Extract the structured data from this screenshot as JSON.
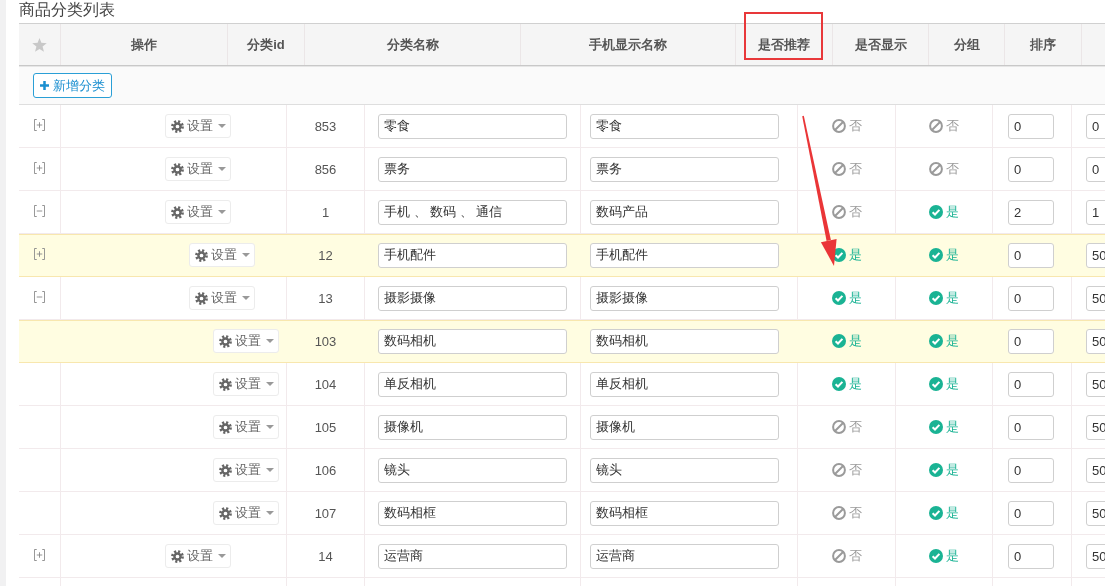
{
  "page": {
    "title": "商品分类列表"
  },
  "table": {
    "columns": [
      {
        "kind": "star",
        "highlighted": false
      },
      {
        "kind": "text",
        "label": "操作",
        "highlighted": false
      },
      {
        "kind": "text",
        "label": "分类id",
        "highlighted": false
      },
      {
        "kind": "text",
        "label": "分类名称",
        "highlighted": false
      },
      {
        "kind": "text",
        "label": "手机显示名称",
        "highlighted": false
      },
      {
        "kind": "text",
        "label": "是否推荐",
        "highlighted": true
      },
      {
        "kind": "text",
        "label": "是否显示",
        "highlighted": false
      },
      {
        "kind": "text",
        "label": "分组",
        "highlighted": false
      },
      {
        "kind": "text",
        "label": "排序",
        "highlighted": false
      }
    ],
    "toolbar": {
      "add_button": "新增分类"
    },
    "rows": [
      {
        "id": "853",
        "action": "设置",
        "name": "零食",
        "mobile_name": "零食",
        "recommended": {
          "on": false,
          "label": "否"
        },
        "visible": {
          "on": false,
          "label": "否"
        },
        "group": "0",
        "sort": "0",
        "expanded": false,
        "selected": false
      },
      {
        "id": "856",
        "action": "设置",
        "name": "票务",
        "mobile_name": "票务",
        "recommended": {
          "on": false,
          "label": "否"
        },
        "visible": {
          "on": false,
          "label": "否"
        },
        "group": "0",
        "sort": "0",
        "expanded": false,
        "selected": false
      },
      {
        "id": "1",
        "action": "设置",
        "name": "手机 、 数码 、 通信",
        "mobile_name": "数码产品",
        "recommended": {
          "on": false,
          "label": "否"
        },
        "visible": {
          "on": true,
          "label": "是"
        },
        "group": "2",
        "sort": "1",
        "expanded": true,
        "selected": false,
        "children": [
          {
            "id": "12",
            "action": "设置",
            "name": "手机配件",
            "mobile_name": "手机配件",
            "recommended": {
              "on": true,
              "label": "是"
            },
            "visible": {
              "on": true,
              "label": "是"
            },
            "group": "0",
            "sort": "50",
            "expanded": false,
            "selected": true
          },
          {
            "id": "13",
            "action": "设置",
            "name": "摄影摄像",
            "mobile_name": "摄影摄像",
            "recommended": {
              "on": true,
              "label": "是"
            },
            "visible": {
              "on": true,
              "label": "是"
            },
            "group": "0",
            "sort": "50",
            "expanded": true,
            "selected": false,
            "children": [
              {
                "id": "103",
                "action": "设置",
                "name": "数码相机",
                "mobile_name": "数码相机",
                "recommended": {
                  "on": true,
                  "label": "是"
                },
                "visible": {
                  "on": true,
                  "label": "是"
                },
                "group": "0",
                "sort": "50",
                "selected": true
              },
              {
                "id": "104",
                "action": "设置",
                "name": "单反相机",
                "mobile_name": "单反相机",
                "recommended": {
                  "on": true,
                  "label": "是"
                },
                "visible": {
                  "on": true,
                  "label": "是"
                },
                "group": "0",
                "sort": "50",
                "selected": false
              },
              {
                "id": "105",
                "action": "设置",
                "name": "摄像机",
                "mobile_name": "摄像机",
                "recommended": {
                  "on": false,
                  "label": "否"
                },
                "visible": {
                  "on": true,
                  "label": "是"
                },
                "group": "0",
                "sort": "50",
                "selected": false
              },
              {
                "id": "106",
                "action": "设置",
                "name": "镜头",
                "mobile_name": "镜头",
                "recommended": {
                  "on": false,
                  "label": "否"
                },
                "visible": {
                  "on": true,
                  "label": "是"
                },
                "group": "0",
                "sort": "50",
                "selected": false
              },
              {
                "id": "107",
                "action": "设置",
                "name": "数码相框",
                "mobile_name": "数码相框",
                "recommended": {
                  "on": false,
                  "label": "否"
                },
                "visible": {
                  "on": true,
                  "label": "是"
                },
                "group": "0",
                "sort": "50",
                "selected": false
              }
            ]
          }
        ]
      },
      {
        "id": "14",
        "action": "设置",
        "name": "运营商",
        "mobile_name": "运营商",
        "recommended": {
          "on": false,
          "label": "否"
        },
        "visible": {
          "on": true,
          "label": "是"
        },
        "group": "0",
        "sort": "50",
        "expanded": false,
        "selected": false
      }
    ]
  },
  "annotations": [
    {
      "kind": "arrow"
    }
  ]
}
